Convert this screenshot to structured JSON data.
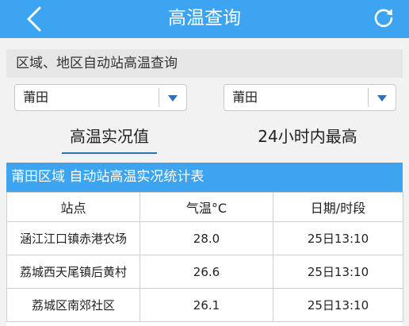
{
  "header": {
    "title": "高温查询",
    "back_icon": "chevron-left-icon",
    "refresh_icon": "refresh-icon"
  },
  "section": {
    "label": "区域、地区自动站高温查询"
  },
  "selects": [
    {
      "value": "莆田"
    },
    {
      "value": "莆田"
    }
  ],
  "tabs": [
    {
      "label": "高温实况值",
      "active": true
    },
    {
      "label": "24小时内最高",
      "active": false
    }
  ],
  "table": {
    "title": "莆田区域 自动站高温实况统计表",
    "headers": [
      "站点",
      "气温°C",
      "日期/时段"
    ],
    "rows": [
      [
        "涵江江口镇赤港农场",
        "28.0",
        "25日13:10"
      ],
      [
        "荔城西天尾镇后黄村",
        "26.6",
        "25日13:10"
      ],
      [
        "荔城区南郊社区",
        "26.1",
        "25日13:10"
      ]
    ]
  },
  "colors": {
    "header_bg": "#3ca4f0",
    "accent": "#2f6fb8"
  }
}
